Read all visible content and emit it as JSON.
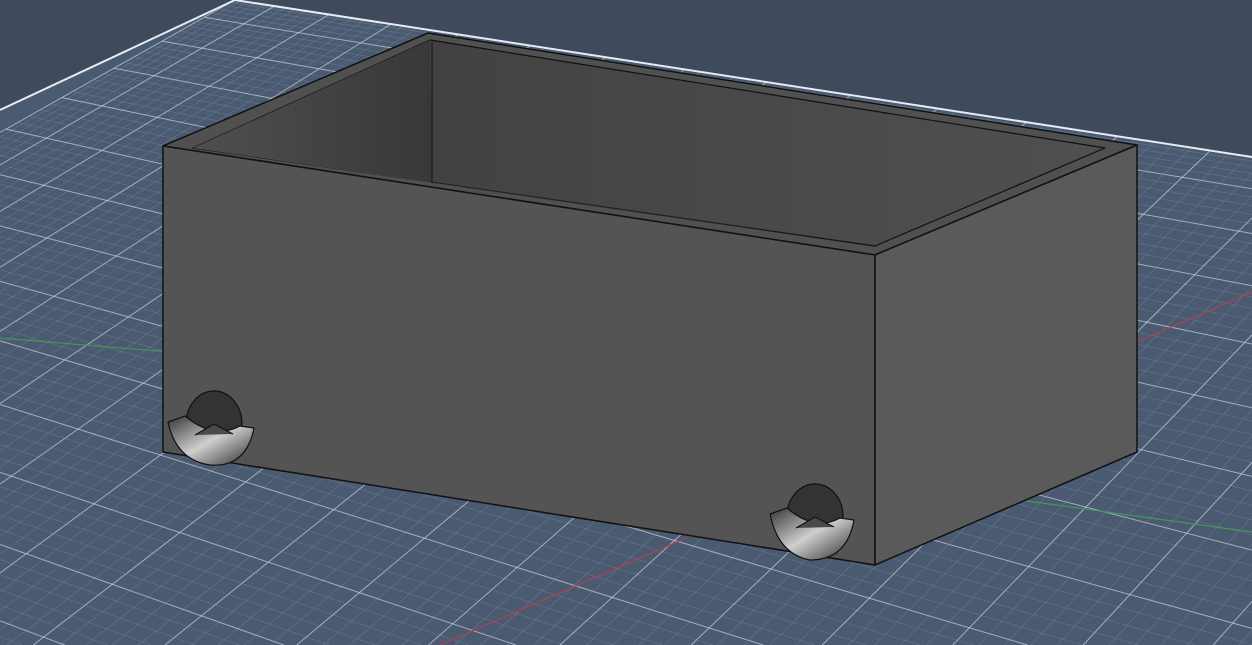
{
  "viewport": {
    "background": "#3f4b5d",
    "plane": "#4a5a70",
    "grid_minor": "#7f8ea3",
    "grid_major": "#c9d2de",
    "axis_x": "#b04050",
    "axis_y": "#3f9a55",
    "model_fill": "#555555",
    "model_side": "#5a5a5a",
    "model_inner": "#4b4b4b",
    "model_edge": "#111111"
  }
}
